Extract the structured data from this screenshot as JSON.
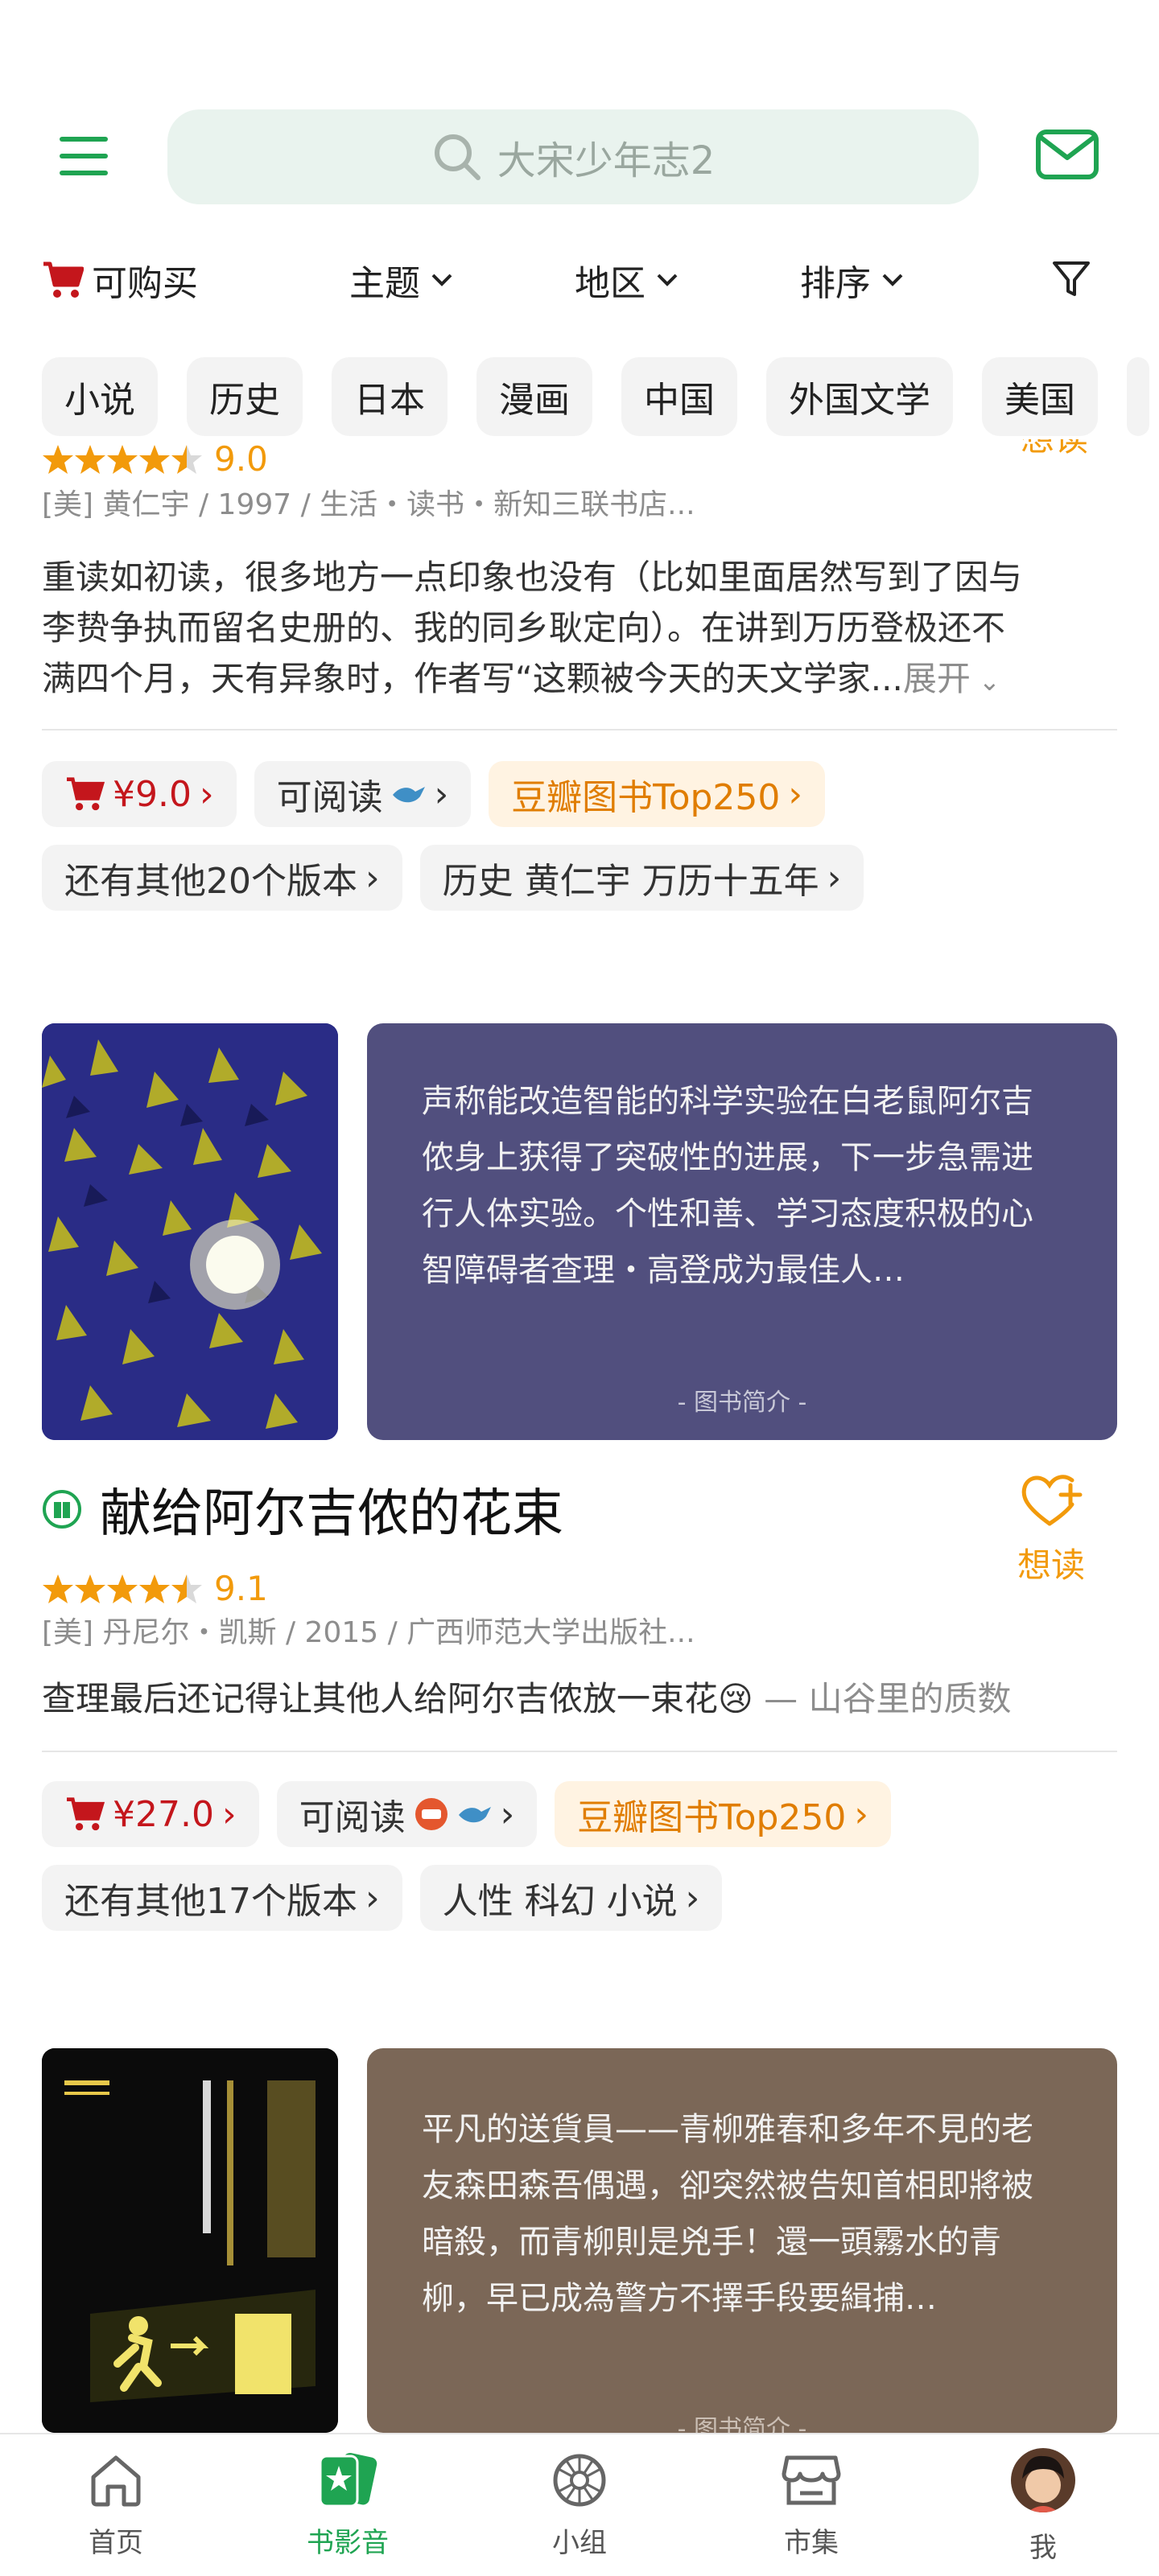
{
  "header": {
    "search_placeholder": "大宋少年志2"
  },
  "filters": [
    {
      "label": "可购买"
    },
    {
      "label": "主题"
    },
    {
      "label": "地区"
    },
    {
      "label": "排序"
    }
  ],
  "chips": [
    "小说",
    "历史",
    "日本",
    "漫画",
    "中国",
    "外国文学",
    "美国"
  ],
  "book1": {
    "partial_want_label": "想读",
    "score": "9.0",
    "meta": "[美] 黄仁宇 / 1997 / 生活・读书・新知三联书店...",
    "review_line1": "重读如初读，很多地方一点印象也没有（比如里面居然写到了因与",
    "review_line2": "李贽争执而留名史册的、我的同乡耿定向）。在讲到万历登极还不",
    "review_line3": "满四个月，天有异象时，作者写“这颗被今天的天文学家...",
    "expand": "展开",
    "price": "¥9.0",
    "readable": "可阅读",
    "top250": "豆瓣图书Top250",
    "versions": "还有其他20个版本",
    "tags": "历史 黄仁宇 万历十五年"
  },
  "book2": {
    "description": "声称能改造智能的科学实验在白老鼠阿尔吉侬身上获得了突破性的进展，下一步急需进行人体实验。个性和善、学习态度积极的心智障碍者查理・高登成为最佳人…",
    "desc_label": "-  图书简介  -",
    "title": "献给阿尔吉侬的花束",
    "want": "想读",
    "score": "9.1",
    "meta": "[美] 丹尼尔・凯斯 / 2015 / 广西师范大学出版社...",
    "quote": "查理最后还记得让其他人给阿尔吉侬放一束花😢",
    "quote_author": "— 山谷里的质数",
    "price": "¥27.0",
    "readable": "可阅读",
    "top250": "豆瓣图书Top250",
    "versions": "还有其他17个版本",
    "tags": "人性 科幻 小说"
  },
  "book3": {
    "description": "平凡的送貨員——青柳雅春和多年不見的老友森田森吾偶遇，卻突然被告知首相即將被暗殺，而青柳則是兇手！還一頭霧水的青柳，早已成為警方不擇手段要緝捕…",
    "desc_label": "-  图书简介  -"
  },
  "nav": [
    {
      "label": "首页",
      "icon": "home-icon"
    },
    {
      "label": "书影音",
      "icon": "media-icon"
    },
    {
      "label": "小组",
      "icon": "group-icon"
    },
    {
      "label": "市集",
      "icon": "market-icon"
    },
    {
      "label": "我",
      "icon": "avatar"
    }
  ],
  "colors": {
    "accent": "#1fa452",
    "star": "#f29a0b",
    "price": "#c4161c",
    "card2": "#514f7e",
    "card3": "#7b6757"
  }
}
